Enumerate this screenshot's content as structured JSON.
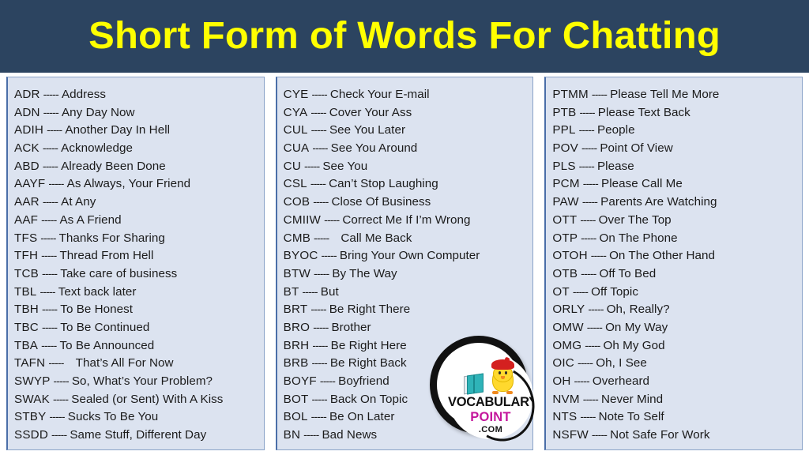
{
  "header": {
    "title": "Short Form of Words For Chatting",
    "background_color": "#2C4460",
    "title_color": "#FFFF00"
  },
  "panel": {
    "background_color": "#DCE3F0",
    "border_color": "#4A6EA8",
    "text_color": "#1B1B1B",
    "separator": "-----"
  },
  "logo": {
    "word_1": "VOCABULARY",
    "word_2": "POINT",
    "word_3": ".COM",
    "word_1_color": "#111111",
    "word_2_color": "#C4179C",
    "word_3_color": "#111111",
    "ring_color": "#111111",
    "chick_color": "#FFD92E",
    "hat_color": "#D42020",
    "book_color": "#2FB3B8"
  },
  "columns": [
    {
      "id": "column-1",
      "entries": [
        {
          "abbr": "ADR",
          "sep": "-----",
          "meaning": "Address"
        },
        {
          "abbr": "ADN",
          "sep": "-----",
          "meaning": "Any Day Now"
        },
        {
          "abbr": "ADIH",
          "sep": "-----",
          "meaning": "Another Day In Hell"
        },
        {
          "abbr": "ACK",
          "sep": "-----",
          "meaning": "Acknowledge"
        },
        {
          "abbr": "ABD",
          "sep": "-----",
          "meaning": "Already Been Done"
        },
        {
          "abbr": "AAYF",
          "sep": "-----",
          "meaning": "As Always, Your Friend"
        },
        {
          "abbr": "AAR",
          "sep": "-----",
          "meaning": "At Any"
        },
        {
          "abbr": "AAF",
          "sep": "-----",
          "meaning": "As A Friend"
        },
        {
          "abbr": "TFS",
          "sep": "-----",
          "meaning": "Thanks For Sharing"
        },
        {
          "abbr": "TFH",
          "sep": "-----",
          "meaning": "Thread From Hell"
        },
        {
          "abbr": "TCB",
          "sep": "-----",
          "meaning": "Take care of business"
        },
        {
          "abbr": "TBL",
          "sep": "-----",
          "meaning": "Text back later"
        },
        {
          "abbr": "TBH",
          "sep": "-----",
          "meaning": "To Be Honest"
        },
        {
          "abbr": "TBC",
          "sep": "-----",
          "meaning": "To Be Continued"
        },
        {
          "abbr": "TBA",
          "sep": "-----",
          "meaning": "To Be Announced"
        },
        {
          "abbr": "TAFN",
          "sep": "-----",
          "meaning": "That’s All For Now"
        },
        {
          "abbr": "SWYP",
          "sep": "-----",
          "meaning": "So, What’s Your Problem?"
        },
        {
          "abbr": "SWAK",
          "sep": "-----",
          "meaning": "Sealed (or Sent) With A Kiss"
        },
        {
          "abbr": "STBY",
          "sep": "-----",
          "meaning": "Sucks To Be You"
        },
        {
          "abbr": "SSDD",
          "sep": "-----",
          "meaning": "Same Stuff, Different Day"
        }
      ]
    },
    {
      "id": "column-2",
      "entries": [
        {
          "abbr": "CYE",
          "sep": "-----",
          "meaning": "Check Your E-mail"
        },
        {
          "abbr": "CYA",
          "sep": "-----",
          "meaning": "Cover Your Ass"
        },
        {
          "abbr": "CUL",
          "sep": "-----",
          "meaning": "See You Later"
        },
        {
          "abbr": "CUA",
          "sep": "-----",
          "meaning": "See You Around"
        },
        {
          "abbr": "CU",
          "sep": "-----",
          "meaning": "See You"
        },
        {
          "abbr": "CSL",
          "sep": "-----",
          "meaning": "Can’t Stop Laughing"
        },
        {
          "abbr": "COB",
          "sep": "-----",
          "meaning": "Close Of Business"
        },
        {
          "abbr": "CMIIW",
          "sep": "-----",
          "meaning": "Correct Me If I’m Wrong"
        },
        {
          "abbr": "CMB",
          "sep": "-----",
          "meaning": "Call Me Back"
        },
        {
          "abbr": "BYOC",
          "sep": "-----",
          "meaning": "Bring Your Own Computer"
        },
        {
          "abbr": "BTW",
          "sep": "-----",
          "meaning": "By The Way"
        },
        {
          "abbr": "BT",
          "sep": "-----",
          "meaning": "But"
        },
        {
          "abbr": "BRT",
          "sep": "-----",
          "meaning": "Be Right There"
        },
        {
          "abbr": "BRO",
          "sep": "-----",
          "meaning": "Brother"
        },
        {
          "abbr": "BRH",
          "sep": "-----",
          "meaning": "Be Right Here"
        },
        {
          "abbr": "BRB",
          "sep": "-----",
          "meaning": "Be Right Back"
        },
        {
          "abbr": "BOYF",
          "sep": "-----",
          "meaning": "Boyfriend"
        },
        {
          "abbr": "BOT",
          "sep": "-----",
          "meaning": "Back On Topic"
        },
        {
          "abbr": "BOL",
          "sep": "-----",
          "meaning": "Be On Later"
        },
        {
          "abbr": "BN",
          "sep": "-----",
          "meaning": "Bad News"
        }
      ]
    },
    {
      "id": "column-3",
      "entries": [
        {
          "abbr": "PTMM",
          "sep": "-----",
          "meaning": "Please Tell Me More"
        },
        {
          "abbr": "PTB",
          "sep": "-----",
          "meaning": "Please Text Back"
        },
        {
          "abbr": "PPL",
          "sep": "-----",
          "meaning": "People"
        },
        {
          "abbr": "POV",
          "sep": "-----",
          "meaning": "Point Of View"
        },
        {
          "abbr": "PLS",
          "sep": "-----",
          "meaning": "Please"
        },
        {
          "abbr": "PCM",
          "sep": "-----",
          "meaning": "Please Call Me"
        },
        {
          "abbr": "PAW",
          "sep": "-----",
          "meaning": "Parents Are Watching"
        },
        {
          "abbr": "OTT",
          "sep": "-----",
          "meaning": "Over The Top"
        },
        {
          "abbr": "OTP",
          "sep": "-----",
          "meaning": "On The Phone"
        },
        {
          "abbr": "OTOH",
          "sep": "-----",
          "meaning": "On The Other Hand"
        },
        {
          "abbr": "OTB",
          "sep": "-----",
          "meaning": "Off To Bed"
        },
        {
          "abbr": "OT",
          "sep": "-----",
          "meaning": "Off Topic"
        },
        {
          "abbr": "ORLY",
          "sep": "-----",
          "meaning": "Oh, Really?"
        },
        {
          "abbr": "OMW",
          "sep": "-----",
          "meaning": "On My Way"
        },
        {
          "abbr": "OMG",
          "sep": "-----",
          "meaning": "Oh My God"
        },
        {
          "abbr": "OIC",
          "sep": "-----",
          "meaning": "Oh, I See"
        },
        {
          "abbr": "OH",
          "sep": "-----",
          "meaning": "Overheard"
        },
        {
          "abbr": "NVM",
          "sep": "-----",
          "meaning": "Never Mind"
        },
        {
          "abbr": "NTS",
          "sep": "-----",
          "meaning": "Note To Self"
        },
        {
          "abbr": "NSFW",
          "sep": "-----",
          "meaning": "Not Safe For Work"
        }
      ]
    }
  ]
}
